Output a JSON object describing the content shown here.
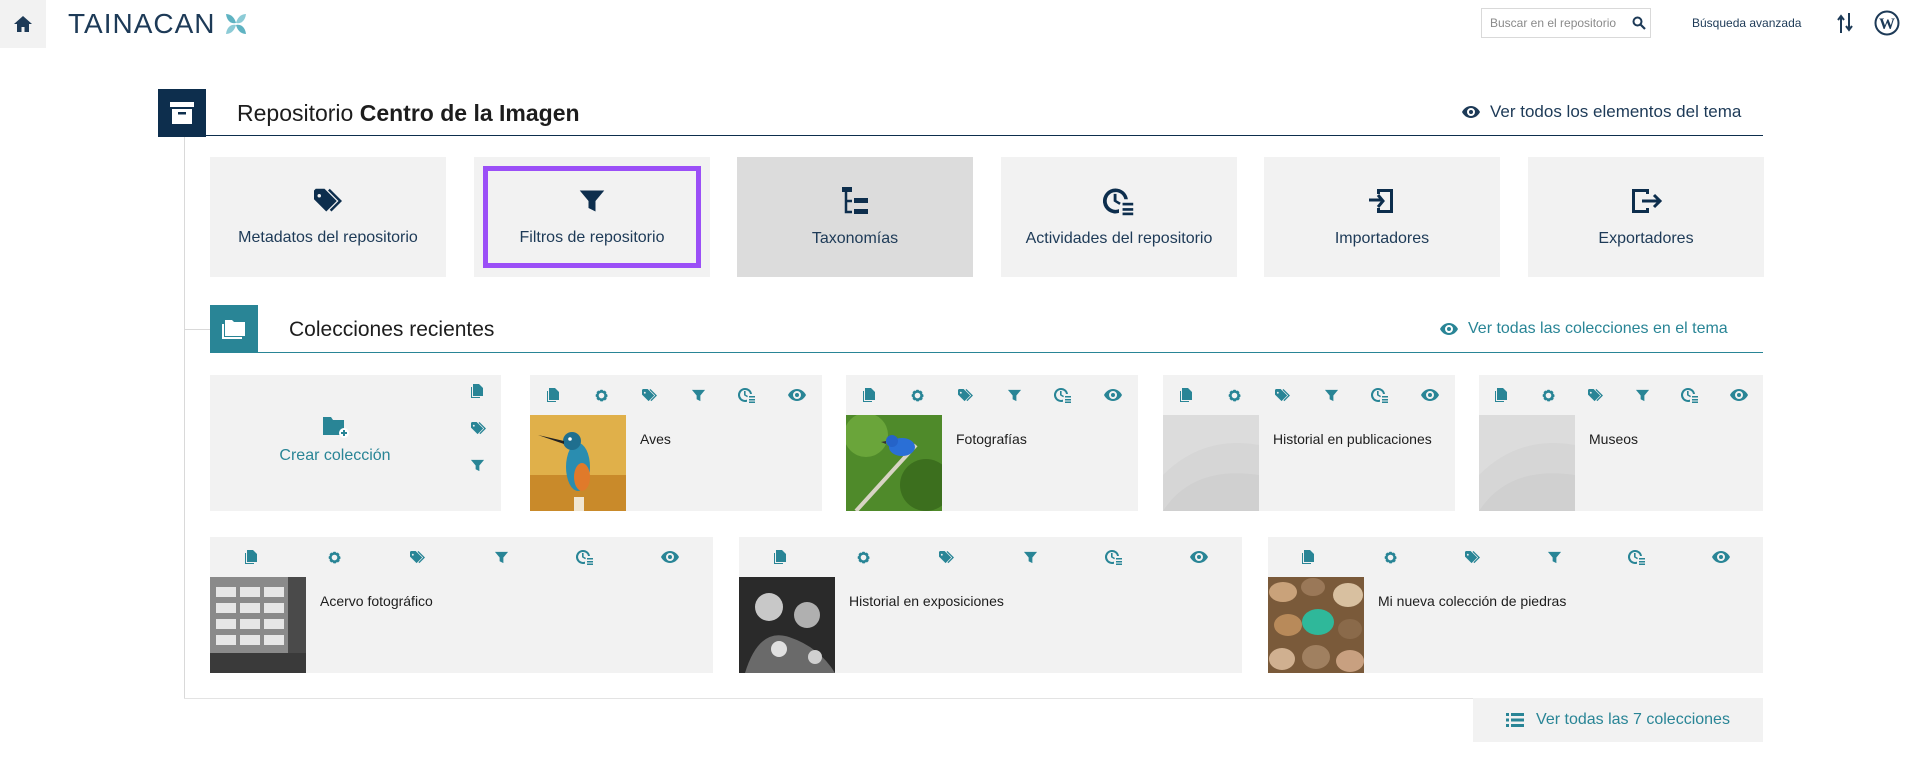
{
  "topbar": {
    "logo_text": "TAINACAN",
    "search_placeholder": "Buscar en el repositorio",
    "advanced_search": "Búsqueda avanzada"
  },
  "repository": {
    "title_prefix": "Repositorio",
    "title_name": "Centro de la Imagen",
    "view_all_items": "Ver todos los elementos del tema"
  },
  "admin_cards": [
    {
      "label": "Metadatos del repositorio",
      "icon": "tags-icon"
    },
    {
      "label": "Filtros de repositorio",
      "icon": "filter-icon",
      "selected": true
    },
    {
      "label": "Taxonomías",
      "icon": "taxonomy-icon",
      "hover": true
    },
    {
      "label": "Actividades del repositorio",
      "icon": "activities-icon"
    },
    {
      "label": "Importadores",
      "icon": "import-icon"
    },
    {
      "label": "Exportadores",
      "icon": "export-icon"
    }
  ],
  "collections_section": {
    "title": "Colecciones recientes",
    "view_all": "Ver todas las colecciones en el tema",
    "create_label": "Crear colección",
    "view_total": "Ver todas las 7 colecciones"
  },
  "collections": [
    {
      "name": "Aves",
      "thumb": "kingfisher"
    },
    {
      "name": "Fotografías",
      "thumb": "blue-bird"
    },
    {
      "name": "Historial en publicaciones",
      "thumb": "placeholder"
    },
    {
      "name": "Museos",
      "thumb": "placeholder"
    },
    {
      "name": "Acervo fotográfico",
      "thumb": "drawers-bw"
    },
    {
      "name": "Historial en exposiciones",
      "thumb": "people-bw"
    },
    {
      "name": "Mi nueva colección de piedras",
      "thumb": "stones"
    }
  ],
  "colors": {
    "navy": "#0d2e4d",
    "teal": "#298596",
    "selection": "#9b4ff7",
    "card": "#f2f2f2"
  }
}
